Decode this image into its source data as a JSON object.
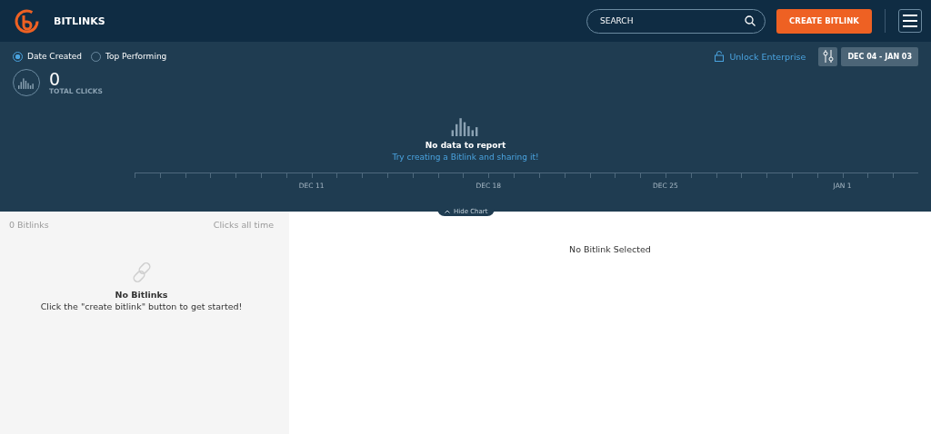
{
  "header": {
    "title": "BITLINKS",
    "search": {
      "placeholder": "SEARCH"
    },
    "create_button": "CREATE BITLINK"
  },
  "chart_panel": {
    "sort_options": [
      {
        "label": "Date Created",
        "selected": true
      },
      {
        "label": "Top Performing",
        "selected": false
      }
    ],
    "unlock_link": "Unlock Enterprise",
    "date_range": "DEC 04 - JAN 03",
    "total_clicks": {
      "value": "0",
      "label": "TOTAL CLICKS"
    },
    "empty_title": "No data to report",
    "empty_link": "Try creating a Bitlink and sharing it!",
    "axis_labels": [
      "DEC 11",
      "DEC 18",
      "DEC 25",
      "JAN 1"
    ],
    "hide_chart": "Hide Chart"
  },
  "list_panel": {
    "count": "0 Bitlinks",
    "sort_label": "Clicks all time",
    "empty_title": "No Bitlinks",
    "empty_text": "Click the \"create bitlink\" button to get started!"
  },
  "detail_panel": {
    "empty_text": "No Bitlink Selected"
  }
}
